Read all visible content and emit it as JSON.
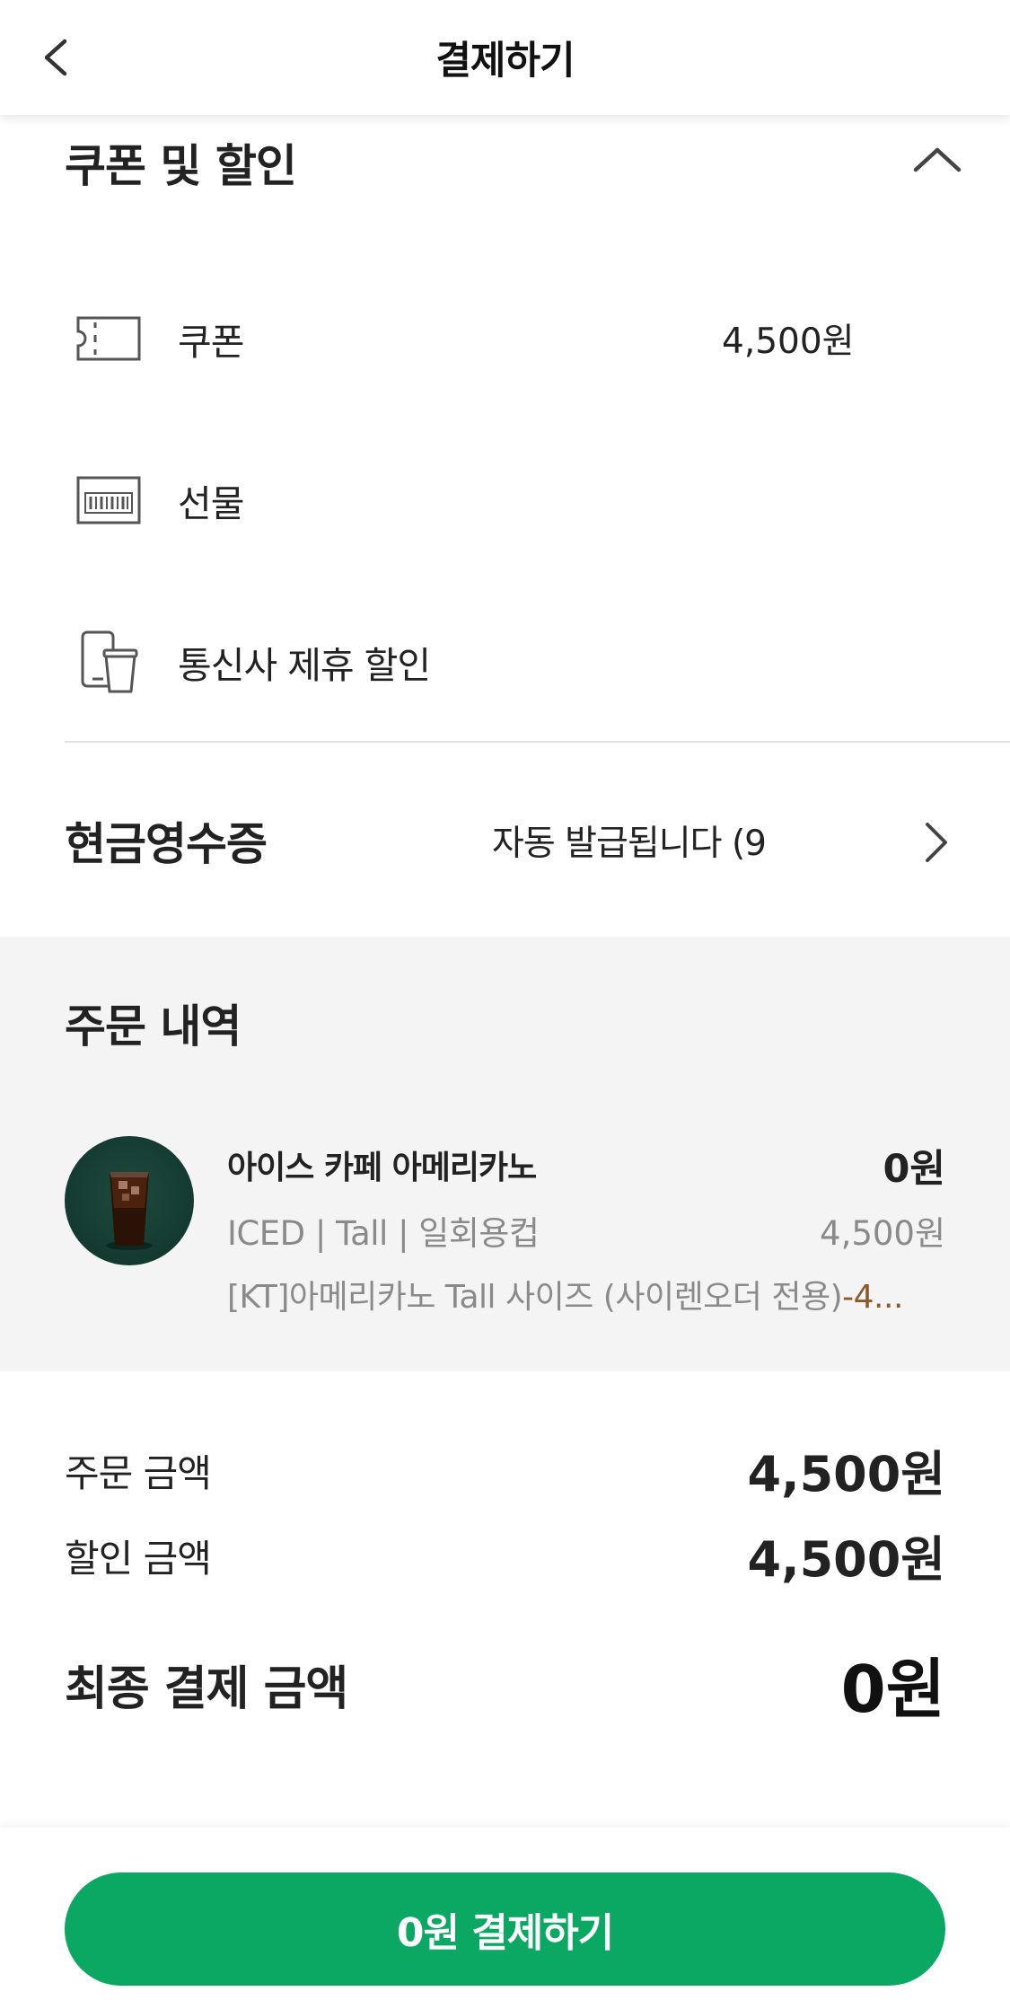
{
  "header": {
    "title": "결제하기",
    "back_icon": "chevron-left-icon"
  },
  "coupon_section": {
    "title": "쿠폰 및 할인",
    "toggle_icon": "chevron-up-icon",
    "items": [
      {
        "label": "쿠폰",
        "value": "4,500원",
        "icon": "ticket-icon"
      },
      {
        "label": "선물",
        "value": "",
        "icon": "gift-card-icon"
      },
      {
        "label": "통신사 제휴 할인",
        "value": "",
        "icon": "phone-cup-icon"
      }
    ]
  },
  "cash_receipt": {
    "label": "현금영수증",
    "value": "자동 발급됩니다 (9",
    "arrow_icon": "chevron-right-icon"
  },
  "order_history": {
    "title": "주문 내역",
    "item": {
      "name": "아이스 카페 아메리카노",
      "price": "0원",
      "options": "ICED | Tall | 일회용컵",
      "original_price": "4,500원",
      "promo_text": "[KT]아메리카노 Tall 사이즈 (사이렌오더 전용)",
      "promo_amount": "-4...",
      "image_icon": "iced-americano-image"
    }
  },
  "summary": {
    "order_amount_label": "주문 금액",
    "order_amount": "4,500원",
    "discount_amount_label": "할인 금액",
    "discount_amount": "4,500원",
    "final_label": "최종 결제 금액",
    "final_amount": "0원"
  },
  "pay_button": {
    "label": "0원 결제하기",
    "color": "#0aa862"
  }
}
